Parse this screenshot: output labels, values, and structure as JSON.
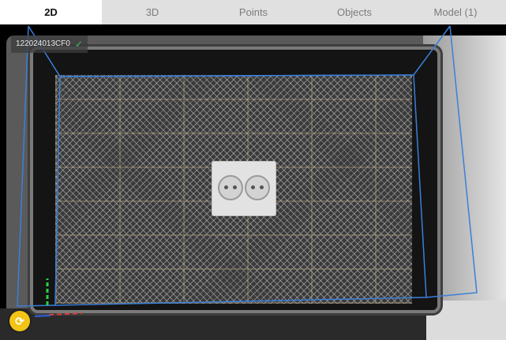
{
  "tabs": [
    {
      "label": "2D",
      "active": true
    },
    {
      "label": "3D",
      "active": false
    },
    {
      "label": "Points",
      "active": false
    },
    {
      "label": "Objects",
      "active": false
    },
    {
      "label": "Model (1)",
      "active": false
    }
  ],
  "camera": {
    "id_label": "122024013CF0",
    "status_icon": "check-icon"
  },
  "status_button": {
    "icon": "camera-switch-icon"
  },
  "colors": {
    "workspace_outline": "#3b7fd9",
    "axis_y": "#26d43c",
    "axis_x": "#e23a3a",
    "axis_z": "#2f5fe0",
    "check": "#3fbf5a",
    "status_button": "#f2c416"
  }
}
